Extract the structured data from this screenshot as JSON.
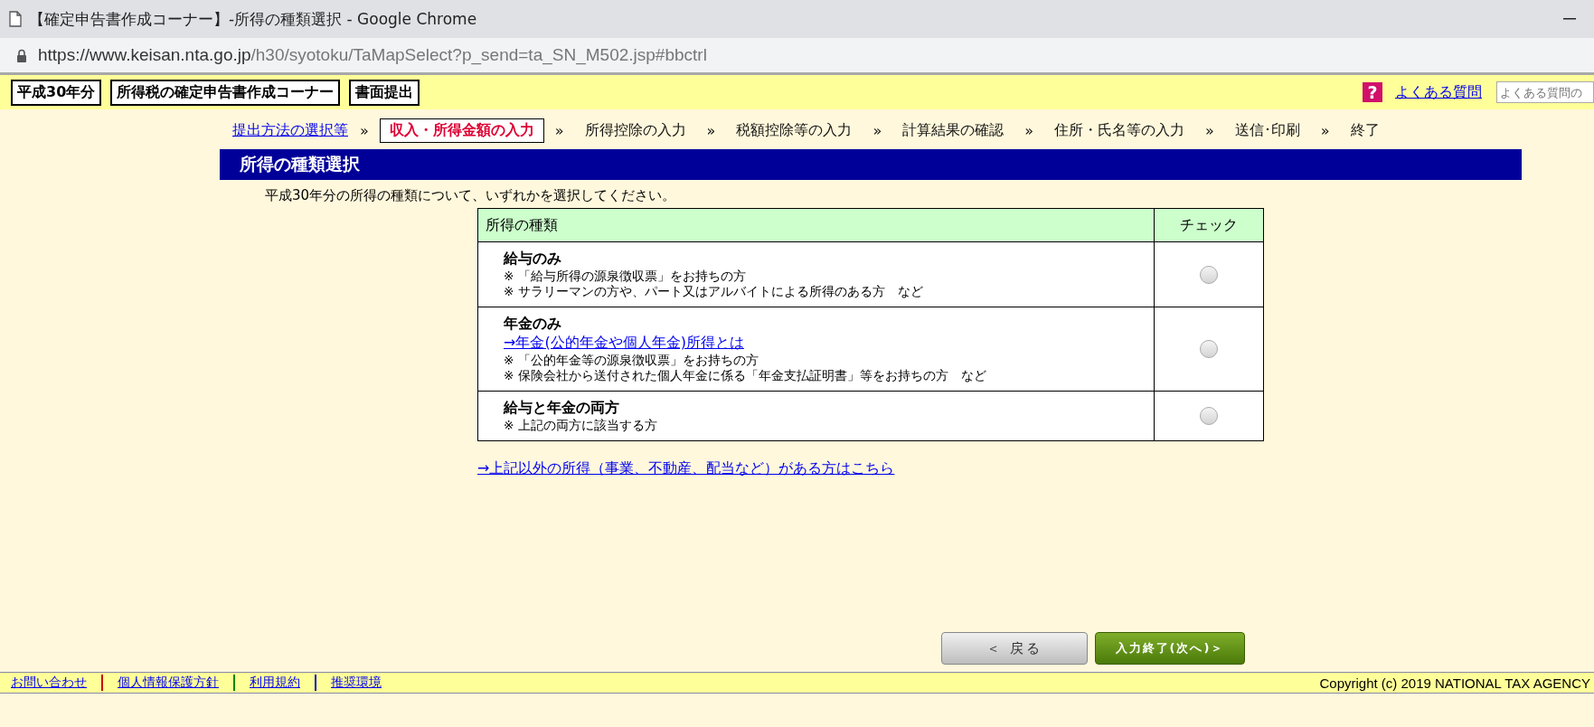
{
  "window": {
    "title": "【確定申告書作成コーナー】-所得の種類選択 - Google Chrome",
    "url_host": "https://www.keisan.nta.go.jp",
    "url_path": "/h30/syotoku/TaMapSelect?p_send=ta_SN_M502.jsp#bbctrl"
  },
  "header": {
    "badges": [
      "平成30年分",
      "所得税の確定申告書作成コーナー",
      "書面提出"
    ],
    "faq_icon": "?",
    "faq_link": "よくある質問",
    "search": {
      "placeholder": "よくある質問の"
    }
  },
  "steps": [
    {
      "label": "提出方法の選択等",
      "kind": "link",
      "selected": false,
      "separator": "»"
    },
    {
      "label": "収入・所得金額の入力",
      "kind": "current",
      "selected": true,
      "separator": "»"
    },
    {
      "label": "所得控除の入力",
      "kind": "plain",
      "selected": false,
      "separator": "»"
    },
    {
      "label": "税額控除等の入力",
      "kind": "plain",
      "selected": false,
      "separator": "»"
    },
    {
      "label": "計算結果の確認",
      "kind": "plain",
      "selected": false,
      "separator": "»"
    },
    {
      "label": "住所・氏名等の入力",
      "kind": "plain",
      "selected": false,
      "separator": "»"
    },
    {
      "label": "送信･印刷",
      "kind": "plain",
      "selected": false,
      "separator": "»"
    },
    {
      "label": "終了",
      "kind": "plain",
      "selected": false
    }
  ],
  "page_title": "所得の種類選択",
  "instruction": "平成30年分の所得の種類について、いずれかを選択してください。",
  "table": {
    "columns": [
      "所得の種類",
      "チェック"
    ],
    "rows": [
      {
        "title": "給与のみ",
        "notes": [
          "※ 「給与所得の源泉徴収票」をお持ちの方",
          "※ サラリーマンの方や、パート又はアルバイトによる所得のある方　など"
        ],
        "checked": false
      },
      {
        "title": "年金のみ",
        "link": "→年金(公的年金や個人年金)所得とは",
        "notes": [
          "※ 「公的年金等の源泉徴収票」をお持ちの方",
          "※ 保険会社から送付された個人年金に係る「年金支払証明書」等をお持ちの方　など"
        ],
        "checked": false
      },
      {
        "title": "給与と年金の両方",
        "notes": [
          "※ 上記の両方に該当する方"
        ],
        "checked": false
      }
    ]
  },
  "other_link": "→上記以外の所得（事業、不動産、配当など）がある方はこちら",
  "buttons": {
    "back": "＜ 戻る",
    "next": "入力終了(次へ)＞"
  },
  "footer": {
    "links": [
      "お問い合わせ",
      "個人情報保護方針",
      "利用規約",
      "推奨環境"
    ],
    "copyright": "Copyright (c) 2019 NATIONAL TAX AGENCY"
  }
}
